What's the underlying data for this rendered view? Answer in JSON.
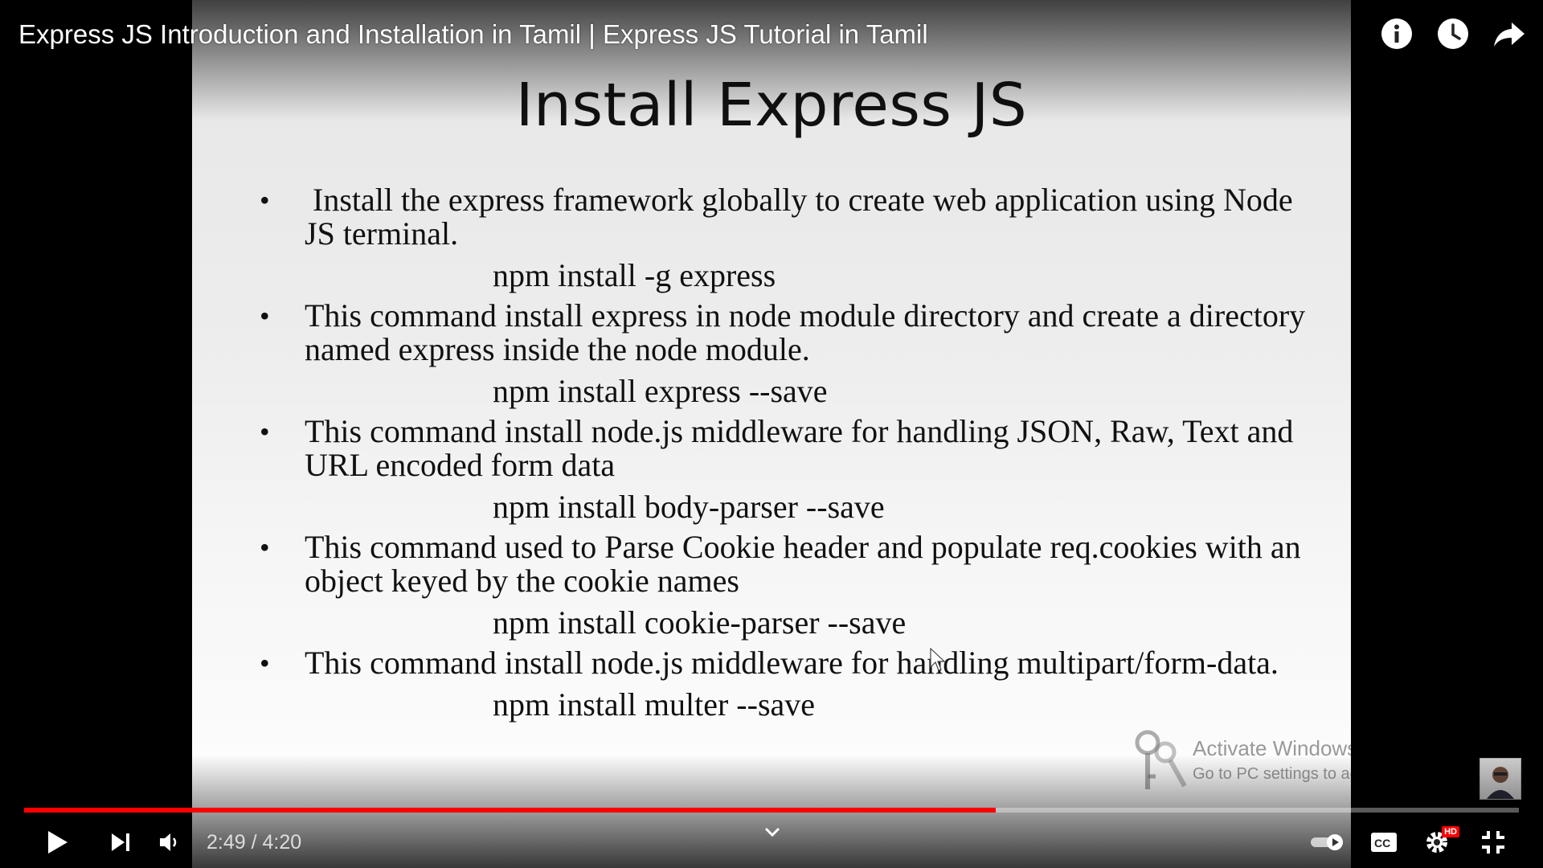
{
  "video": {
    "title": "Express JS Introduction and Installation in Tamil | Express JS Tutorial in Tamil"
  },
  "slide": {
    "title": "Install Express JS",
    "items": [
      {
        "text": " Install the express framework globally to create web application using Node JS terminal.",
        "command": "npm install -g express"
      },
      {
        "text": "This command install express in node module directory and create a directory named express inside the node module.",
        "command": "npm install express --save"
      },
      {
        "text": "This command install node.js middleware for handling JSON, Raw, Text and URL encoded form data",
        "command": "npm install body-parser --save"
      },
      {
        "text": "This command used to Parse Cookie header and populate req.cookies with an object keyed by the cookie names",
        "command": "npm install cookie-parser --save"
      },
      {
        "text": "This command install node.js middleware for handling multipart/form-data.",
        "command": "npm install multer --save"
      }
    ],
    "bullet_char": "•"
  },
  "watermark": {
    "title": "Activate Windows",
    "subtitle": "Go to PC settings to activate Windows."
  },
  "top_icons": [
    "info-icon",
    "watch-later-icon",
    "share-icon"
  ],
  "progress": {
    "played_fraction": 0.65,
    "loaded_fraction": 0.65
  },
  "controls": {
    "time_display": "2:49 / 4:20",
    "hd_label": "HD",
    "icons": [
      "play-icon",
      "next-icon",
      "volume-icon",
      "chevron-down-icon",
      "autoplay-toggle-icon",
      "captions-icon",
      "settings-icon",
      "exit-fullscreen-icon"
    ]
  },
  "colors": {
    "progress_played": "#ff0000",
    "hd_badge": "#ff0000"
  }
}
